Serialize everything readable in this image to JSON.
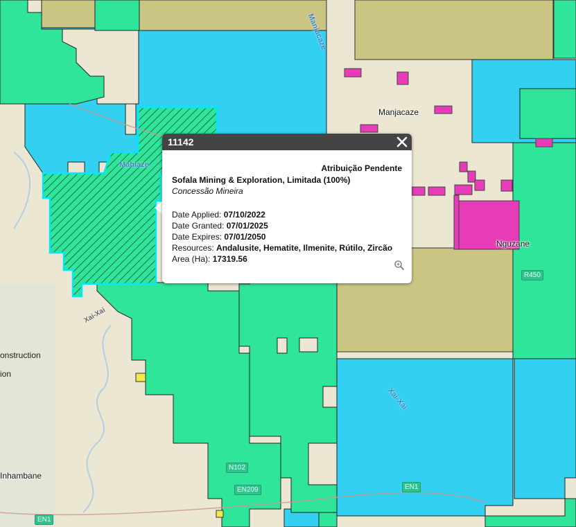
{
  "map": {
    "colors": {
      "base": "#ece7d2",
      "concession_green": "#2ee59a",
      "exploration_blue": "#33d0f2",
      "pending_olive": "#cbc584",
      "mining_pass_magenta": "#e63cb7",
      "border": "#222222",
      "selection": "#00e8ff"
    },
    "place_labels": [
      "Manjacaze",
      "Nguzane",
      "Inhambane"
    ],
    "road_labels": [
      "R450",
      "EN1",
      "EN1",
      "N102",
      "EN209"
    ],
    "river_labels": [
      "Manjacaze",
      "Xai-Xai",
      "Mahlaze",
      "Xai-Xai"
    ],
    "legend_fragments": [
      "onstruction",
      "ion"
    ]
  },
  "popup": {
    "title": "11142",
    "status": "Atribuição Pendente",
    "company": "Sofala Mining & Exploration, Limitada (100%)",
    "type": "Concessão Mineira",
    "fields": [
      {
        "label": "Date Applied:",
        "value": "07/10/2022"
      },
      {
        "label": "Date Granted:",
        "value": "07/01/2025"
      },
      {
        "label": "Date Expires:",
        "value": "07/01/2050"
      },
      {
        "label": "Resources:",
        "value": "Andalusite, Hematite, Ilmenite, Rútilo, Zircão"
      },
      {
        "label": "Area (Ha):",
        "value": "17319.56"
      }
    ],
    "icons": {
      "close": "close-icon",
      "zoom": "zoom-to-icon"
    }
  }
}
